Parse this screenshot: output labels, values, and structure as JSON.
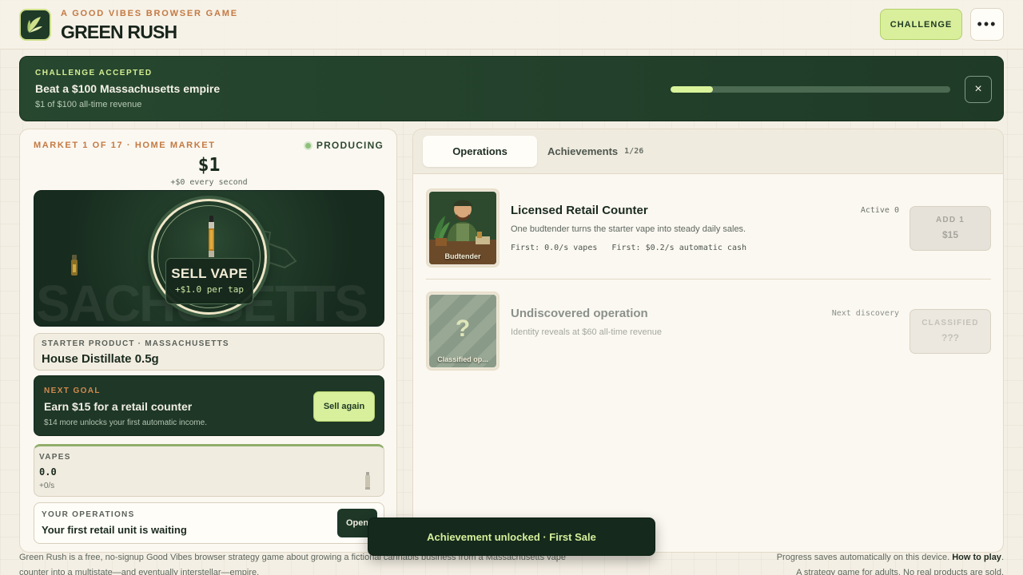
{
  "header": {
    "eyebrow": "A GOOD VIBES BROWSER GAME",
    "title": "GREEN RUSH",
    "challenge_label": "CHALLENGE",
    "more_label": "•••",
    "logo_icon": "leaf-icon"
  },
  "banner": {
    "eyebrow": "CHALLENGE ACCEPTED",
    "title": "Beat a $100 Massachusetts empire",
    "subtitle": "$1 of $100 all-time revenue",
    "progress": 0.15,
    "close_label": "×"
  },
  "market": {
    "label": "MARKET 1 OF 17 · HOME MARKET",
    "status": "PRODUCING",
    "cash": "$1",
    "rate": "+$0 every second",
    "state_watermark": "SACHUSETTS",
    "sell_title": "SELL VAPE",
    "sell_sub": "+$1.0 per tap"
  },
  "product": {
    "eyebrow": "STARTER PRODUCT · MASSACHUSETTS",
    "name": "House Distillate 0.5g"
  },
  "goal": {
    "eyebrow": "NEXT GOAL",
    "title": "Earn $15 for a retail counter",
    "subtitle": "$14 more unlocks your first automatic income.",
    "button_label": "Sell again"
  },
  "vapes": {
    "label": "VAPES",
    "count": "0.0",
    "rate": "+0/s"
  },
  "your_ops": {
    "eyebrow": "YOUR OPERATIONS",
    "title": "Your first retail unit is waiting",
    "button_label": "Open"
  },
  "tabs": {
    "operations": "Operations",
    "achievements": "Achievements",
    "achievements_count": "1/26"
  },
  "operations": [
    {
      "thumb_label": "Budtender",
      "name": "Licensed Retail Counter",
      "description": "One budtender turns the starter vape into steady daily sales.",
      "stats": "First: 0.0/s vapes   First: $0.2/s automatic cash",
      "status": "Active 0",
      "button_line1": "ADD 1",
      "button_line2": "$15"
    },
    {
      "thumb_label": "Classified op...",
      "thumb_glyph": "?",
      "name": "Undiscovered operation",
      "description": "Identity reveals at $60 all-time revenue",
      "status": "Next discovery",
      "button_line1": "CLASSIFIED",
      "button_line2": "???"
    }
  ],
  "footer": {
    "left": "Green Rush is a free, no-signup Good Vibes browser strategy game about growing a fictional cannabis business from a Massachusetts vape counter into a multistate—and eventually interstellar—empire.",
    "right_prefix": "Progress saves automatically on this device.",
    "right_link": "How to play",
    "right_suffix": ".",
    "right_line2": "A strategy game for adults. No real products are sold."
  },
  "toast": {
    "text": "Achievement unlocked · First Sale"
  },
  "colors": {
    "accent_lime": "#d9ef9c",
    "forest": "#1e3727",
    "orange_label": "#c47a43",
    "cream": "#f4efe4"
  }
}
